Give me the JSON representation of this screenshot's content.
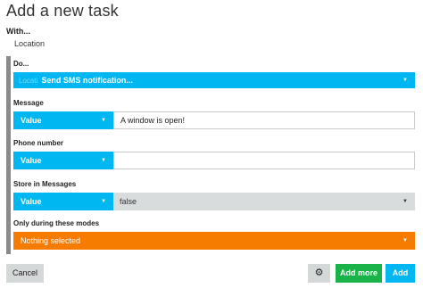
{
  "dialog": {
    "title": "Add a new task"
  },
  "with": {
    "label": "With...",
    "value": "Location"
  },
  "do": {
    "label": "Do...",
    "ghost_text": "Locati",
    "selected": "Send SMS notification..."
  },
  "message": {
    "label": "Message",
    "type": "Value",
    "value": "A window is open!"
  },
  "phone_number": {
    "label": "Phone number",
    "type": "Value",
    "value": ""
  },
  "store_in_messages": {
    "label": "Store in Messages",
    "type": "Value",
    "selected": "false"
  },
  "modes": {
    "label": "Only during these modes",
    "selected": "Nothing selected"
  },
  "buttons": {
    "cancel": "Cancel",
    "add_more": "Add more",
    "add": "Add"
  },
  "icons": {
    "settings": "gear-icon",
    "dropdown": "caret-down-icon"
  },
  "colors": {
    "accent_blue": "#00b7f1",
    "orange": "#f57c00",
    "green": "#1ab34a",
    "neutral": "#d5d8d9"
  }
}
